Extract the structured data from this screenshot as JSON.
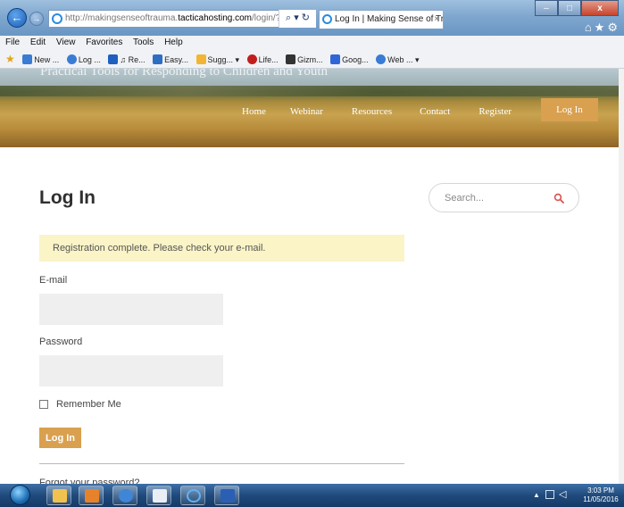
{
  "browser": {
    "url_prefix": "http://makingsenseoftrauma.",
    "url_host": "tacticahosting.com",
    "url_path": "/login/?checkem",
    "address_tools": "⌕ ▾ ↻",
    "tab_title": "Log In | Making Sense of Tr...",
    "tab_close": "×",
    "window_controls": [
      "–",
      "□",
      "x"
    ],
    "toolbar_icons": "⌂★⚙",
    "menu": [
      "File",
      "Edit",
      "View",
      "Favorites",
      "Tools",
      "Help"
    ],
    "favorites": [
      {
        "label": "New ...",
        "icon": "ie-page-icon",
        "color": "#3a7bd5"
      },
      {
        "label": "Log ...",
        "icon": "ie-page-icon",
        "color": "#3a7bd5"
      },
      {
        "label": "♫ Re...",
        "icon": "s-icon",
        "color": "#1f5fbf"
      },
      {
        "label": "Easy...",
        "icon": "ie-icon",
        "color": "#2d6ec4"
      },
      {
        "label": "Sugg... ▾",
        "icon": "suggested-sites-icon",
        "color": "#f2b533"
      },
      {
        "label": "Life...",
        "icon": "life-icon",
        "color": "#c21d1d"
      },
      {
        "label": "Gizm...",
        "icon": "g-icon",
        "color": "#333333"
      },
      {
        "label": "Goog...",
        "icon": "google-icon",
        "color": "#2f68d6"
      },
      {
        "label": "Web ... ▾",
        "icon": "ie-page-icon",
        "color": "#3a7bd5"
      }
    ]
  },
  "site": {
    "tagline": "Practical Tools for Responding to Children and Youth",
    "nav": {
      "home": "Home",
      "webinar": "Webinar",
      "resources": "Resources",
      "contact": "Contact",
      "register": "Register",
      "login": "Log In"
    }
  },
  "content": {
    "title": "Log In",
    "search_placeholder": "Search...",
    "notice": "Registration complete. Please check your e-mail.",
    "email_label": "E-mail",
    "password_label": "Password",
    "remember_label": "Remember Me",
    "login_button": "Log In",
    "forgot_link": "Forgot your password?"
  },
  "taskbar": {
    "clock_time": "3:03 PM",
    "clock_date": "11/05/2016",
    "items": [
      "folder-icon",
      "outlook-icon",
      "media-player-icon",
      "photo-icon",
      "ie-icon",
      "word-icon"
    ]
  },
  "colors": {
    "accent": "#d9a04f",
    "notice_bg": "#fbf4c7",
    "field_bg": "#efefef"
  }
}
